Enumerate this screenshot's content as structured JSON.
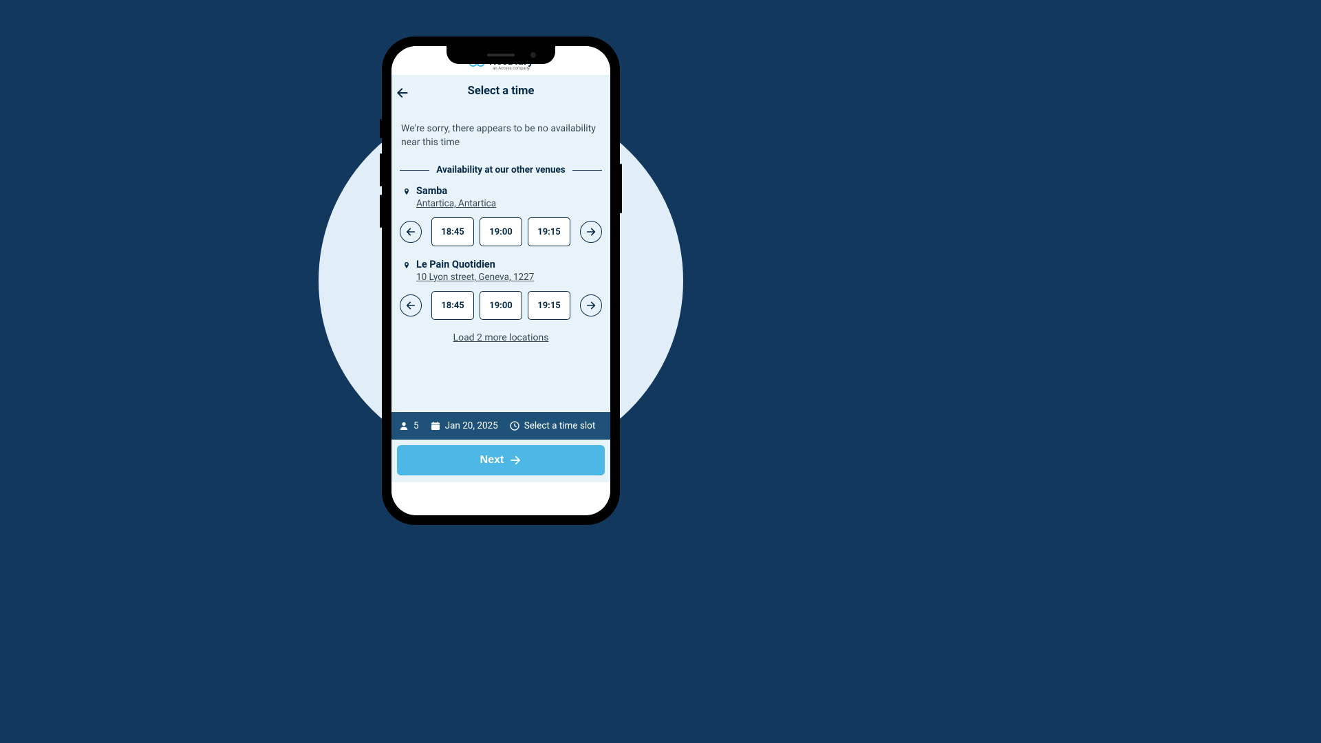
{
  "brand": {
    "name": "ResDiary",
    "sub": "an Access company"
  },
  "page": {
    "title": "Select a time",
    "message": "We're sorry, there appears to be no availability near this time",
    "divider": "Availability at our other venues",
    "loadMore": "Load 2 more locations"
  },
  "venues": [
    {
      "name": "Samba",
      "address": "Antartica, Antartica",
      "slots": [
        "18:45",
        "19:00",
        "19:15"
      ]
    },
    {
      "name": "Le Pain Quotidien",
      "address": "10 Lyon street, Geneva, 1227",
      "slots": [
        "18:45",
        "19:00",
        "19:15"
      ]
    }
  ],
  "summary": {
    "guests": "5",
    "date": "Jan 20, 2025",
    "time": "Select a time slot"
  },
  "next": {
    "label": "Next"
  }
}
